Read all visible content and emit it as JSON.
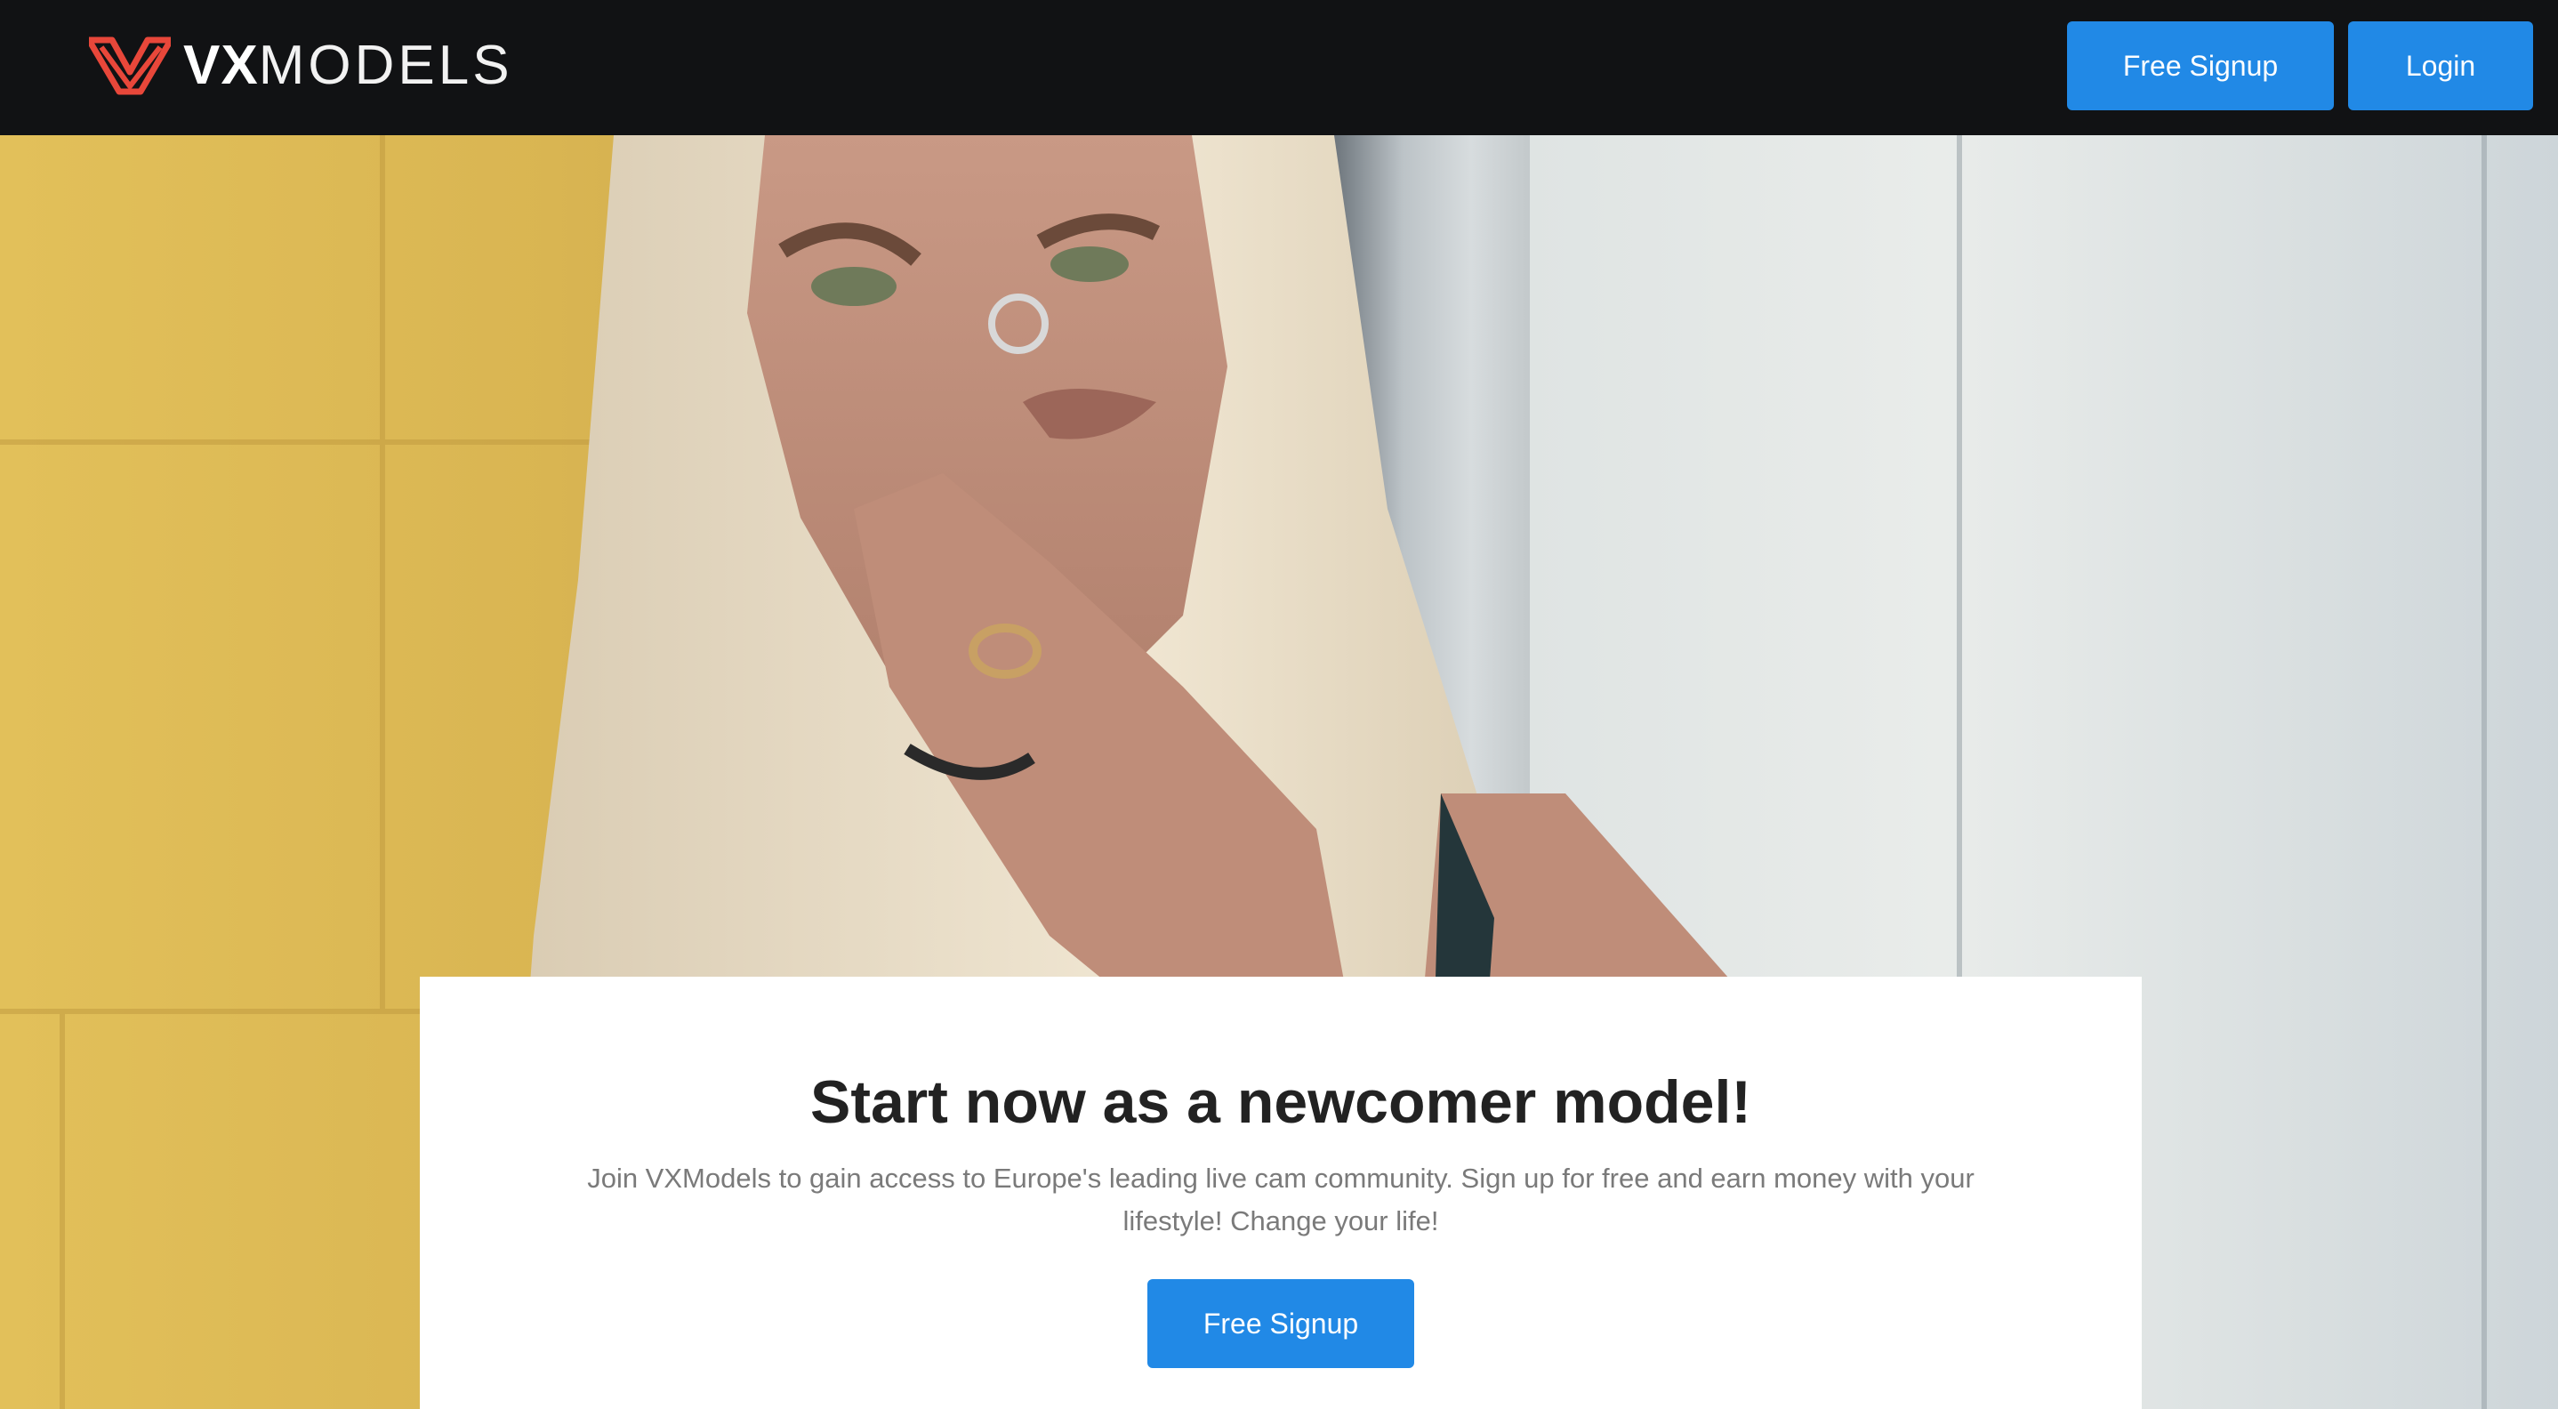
{
  "header": {
    "logo": {
      "brand_bold": "VX",
      "brand_light": "MODELS",
      "icon": "vx-logo-icon"
    },
    "free_signup_label": "Free Signup",
    "login_label": "Login"
  },
  "hero": {
    "image": "woman-portrait-photo"
  },
  "card": {
    "title": "Start now as a newcomer model!",
    "description": "Join VXModels to gain access to Europe's leading live cam community. Sign up for free and earn money with your lifestyle! Change your life!",
    "signup_label": "Free Signup"
  },
  "colors": {
    "accent": "#2189e6",
    "header_bg": "#111214",
    "logo_red": "#e8473a"
  }
}
